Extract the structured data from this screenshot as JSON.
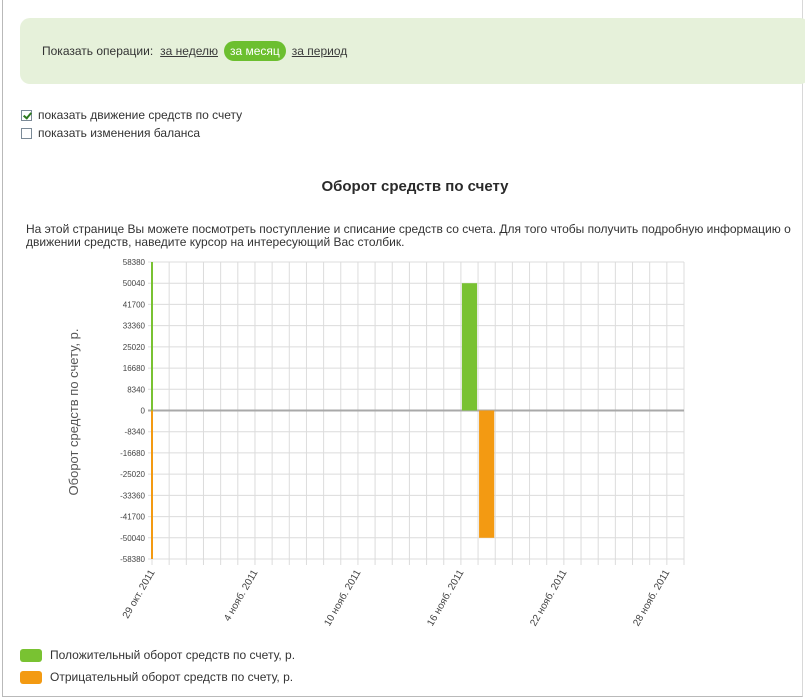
{
  "filter": {
    "label": "Показать операции:",
    "options": [
      "за неделю",
      "за месяц",
      "за период"
    ],
    "selected": "за месяц"
  },
  "checkboxes": [
    {
      "label": "показать движение средств по счету",
      "checked": true
    },
    {
      "label": "показать изменения баланса",
      "checked": false
    }
  ],
  "description": "На этой странице Вы можете посмотреть поступление и списание средств со счета. Для того чтобы получить подробную информацию о движении средств, наведите курсор на интересующий Вас столбик.",
  "colors": {
    "positive": "#79c232",
    "negative": "#f39a12",
    "accent": "#6cbf2f"
  },
  "chart_data": {
    "type": "bar",
    "title": "Оборот средств по счету",
    "ylabel": "Оборот средств по счету, р.",
    "xlabel": "",
    "yticks": [
      "58380",
      "50040",
      "41700",
      "33360",
      "25020",
      "16680",
      "8340",
      "0",
      "-8340",
      "-16680",
      "-25020",
      "-33360",
      "-41700",
      "-50040",
      "-58380"
    ],
    "ylim": [
      -58380,
      58380
    ],
    "xticks": [
      "29 окт. 2011",
      "4 нояб. 2011",
      "10 нояб. 2011",
      "16 нояб. 2011",
      "22 нояб. 2011",
      "28 нояб. 2011"
    ],
    "x_days": 31,
    "series": [
      {
        "name": "Положительный оборот средств по счету, р.",
        "color": "#79c232",
        "points": [
          {
            "day_index": 18,
            "value": 50040
          }
        ]
      },
      {
        "name": "Отрицательный оборот средств по счету, р.",
        "color": "#f39a12",
        "points": [
          {
            "day_index": 19,
            "value": -50040
          }
        ]
      }
    ],
    "grid": true,
    "legend_position": "bottom-left"
  }
}
